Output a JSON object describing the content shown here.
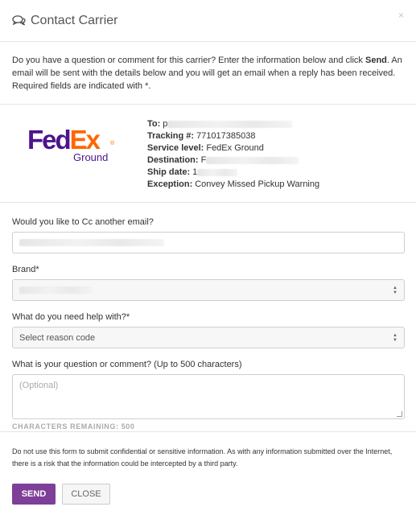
{
  "modal": {
    "title": "Contact Carrier",
    "title_icon": "chat-bubbles-icon",
    "close_symbol": "×"
  },
  "intro": {
    "part1": "Do you have a question or comment for this carrier? Enter the information below and click ",
    "send_word": "Send",
    "part2": ". An email will be sent with the details below and you will get an email when a reply has been received. Required fields are indicated with *."
  },
  "carrier": {
    "logo_fed": "Fed",
    "logo_ex": "Ex",
    "logo_reg": "®",
    "logo_service": "Ground"
  },
  "shipment": {
    "to_label": "To:",
    "to_value": "p",
    "tracking_label": "Tracking #:",
    "tracking_value": "771017385038",
    "service_label": "Service level:",
    "service_value": "FedEx Ground",
    "destination_label": "Destination:",
    "destination_value": "F",
    "ship_date_label": "Ship date:",
    "ship_date_value": "1",
    "exception_label": "Exception:",
    "exception_value": "Convey Missed Pickup Warning"
  },
  "form": {
    "cc_label": "Would you like to Cc another email?",
    "brand_label": "Brand*",
    "reason_label": "What do you need help with?*",
    "reason_value": "Select reason code",
    "question_label": "What is your question or comment? (Up to 500 characters)",
    "question_placeholder": "(Optional)",
    "counter": "CHARACTERS REMAINING: 500"
  },
  "footer": {
    "disclaimer": "Do not use this form to submit confidential or sensitive information. As with any information submitted over the Internet, there is a risk that the information could be intercepted by a third party.",
    "send_label": "SEND",
    "close_label": "CLOSE"
  },
  "colors": {
    "accent": "#7d3f98",
    "fedex_purple": "#4d148c",
    "fedex_orange": "#ff6600"
  }
}
